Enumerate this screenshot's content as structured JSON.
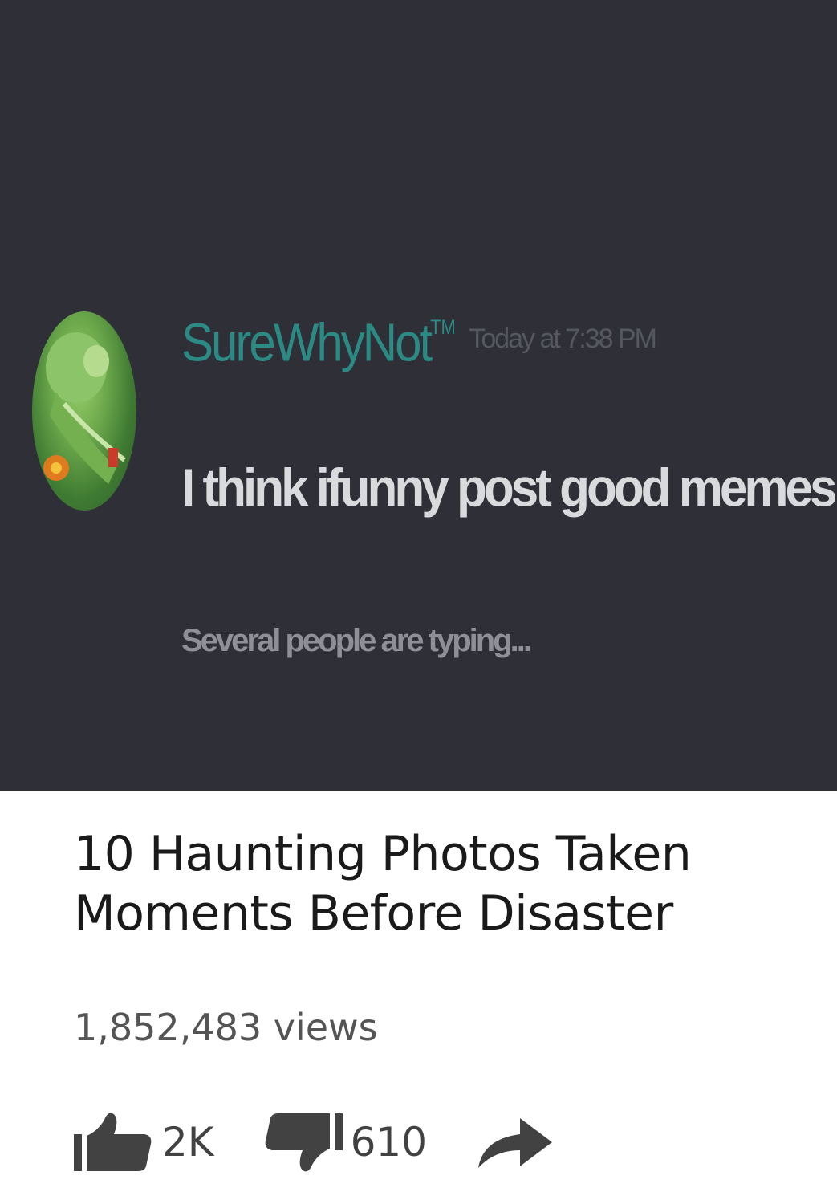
{
  "chat": {
    "username": "SureWhyNot",
    "username_badge": "TM",
    "timestamp": "Today at 7:38 PM",
    "message": "I think ifunny post good memes",
    "typing_indicator": "Several people are typing..."
  },
  "video": {
    "title": "10 Haunting Photos Taken Moments Before Disaster",
    "views": "1,852,483 views",
    "actions": {
      "like_count": "2K",
      "dislike_count": "610",
      "like_icon": "thumbs-up-icon",
      "dislike_icon": "thumbs-down-icon",
      "share_icon": "share-arrow-icon"
    }
  },
  "colors": {
    "chat_background": "#2f3037",
    "username": "#2c8a84",
    "message_text": "#d9dade",
    "muted_text": "#8e9096",
    "video_background": "#ffffff",
    "title_text": "#1a1a1a",
    "icon_gray": "#424242"
  }
}
